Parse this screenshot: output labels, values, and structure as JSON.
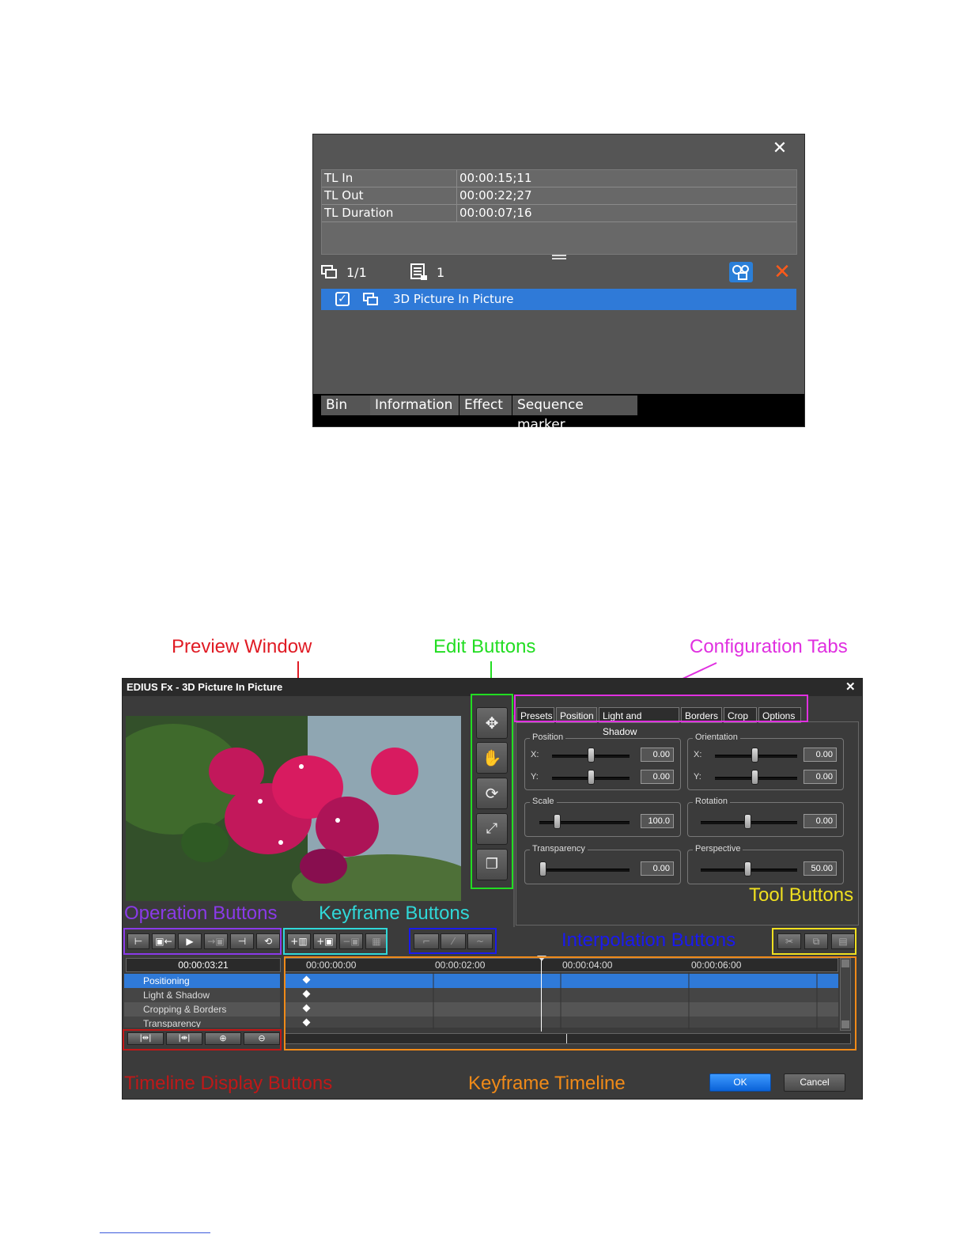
{
  "info_panel": {
    "rows": [
      {
        "key": "TL In",
        "value": "00:00:15;11"
      },
      {
        "key": "TL Out",
        "value": "00:00:22;27"
      },
      {
        "key": "TL Duration",
        "value": "00:00:07;16"
      }
    ],
    "filter_count": "1/1",
    "marker_count": "1",
    "effect_item": "3D Picture In Picture",
    "tabs": [
      "Bin",
      "Information",
      "Effect",
      "Sequence marker"
    ],
    "active_tab": "Information"
  },
  "annotations": {
    "preview_window": "Preview Window",
    "edit_buttons": "Edit Buttons",
    "configuration_tabs": "Configuration Tabs",
    "operation_buttons": "Operation Buttons",
    "keyframe_buttons": "Keyframe Buttons",
    "tool_buttons": "Tool Buttons",
    "interpolation_buttons": "Interpolation Buttons",
    "timeline_display_buttons": "Timeline Display Buttons",
    "keyframe_timeline": "Keyframe Timeline"
  },
  "annotation_colors": {
    "preview": "#e01b24",
    "edit": "#22dd22",
    "config": "#e030e0",
    "operation": "#8a3ae8",
    "keyframe": "#30d8d8",
    "tool": "#f0e020",
    "interpolation": "#1a1aee",
    "timeline_display": "#c01818",
    "keyframe_timeline": "#f08a18"
  },
  "dialog": {
    "title": "EDIUS Fx - 3D Picture In Picture",
    "tabs": [
      "Presets",
      "Position",
      "Light and Shadow",
      "Borders",
      "Crop",
      "Options"
    ],
    "active_tab": "Position",
    "groups": {
      "position": {
        "label": "Position",
        "x_label": "X:",
        "y_label": "Y:",
        "x_value": "0.00",
        "y_value": "0.00"
      },
      "orientation": {
        "label": "Orientation",
        "x_label": "X:",
        "y_label": "Y:",
        "x_value": "0.00",
        "y_value": "0.00"
      },
      "scale": {
        "label": "Scale",
        "value": "100.0"
      },
      "rotation": {
        "label": "Rotation",
        "value": "0.00"
      },
      "transparency": {
        "label": "Transparency",
        "value": "0.00"
      },
      "perspective": {
        "label": "Perspective",
        "value": "50.00"
      }
    },
    "edit_buttons": [
      "move-icon",
      "hand-icon",
      "rotate-icon",
      "scale-icon",
      "frame-icon"
    ],
    "timecode": "00:00:03:21",
    "ruler": [
      "00:00:00:00",
      "00:00:02:00",
      "00:00:04:00",
      "00:00:06:00"
    ],
    "tracks": [
      "Positioning",
      "Light & Shadow",
      "Cropping & Borders",
      "Transparency"
    ],
    "selected_track": "Positioning",
    "ok_label": "OK",
    "cancel_label": "Cancel"
  }
}
